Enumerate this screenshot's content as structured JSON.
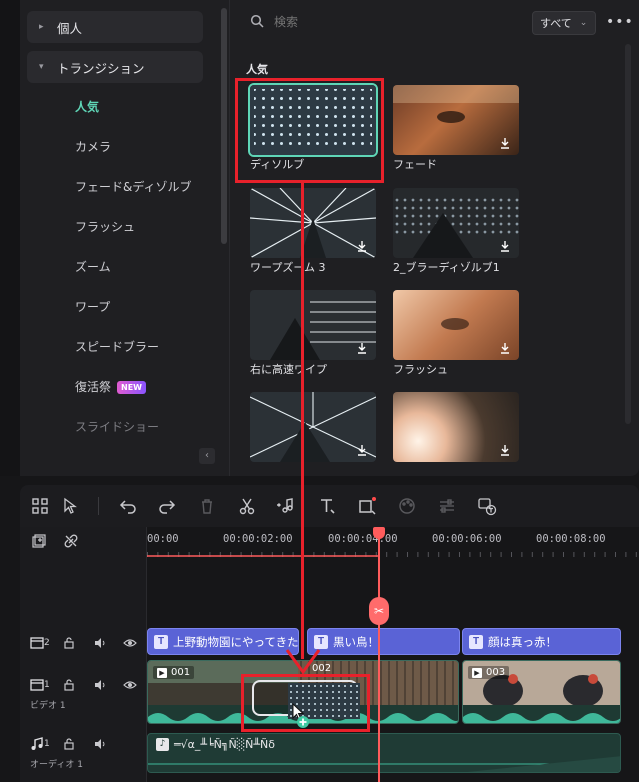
{
  "sidebar": {
    "categories": [
      {
        "label": "個人",
        "expanded": false
      },
      {
        "label": "トランジション",
        "expanded": true
      }
    ],
    "sub_items": [
      {
        "label": "人気",
        "active": true
      },
      {
        "label": "カメラ"
      },
      {
        "label": "フェード&ディゾルブ"
      },
      {
        "label": "フラッシュ"
      },
      {
        "label": "ズーム"
      },
      {
        "label": "ワープ"
      },
      {
        "label": "スピードブラー"
      },
      {
        "label": "復活祭",
        "badge": "NEW"
      },
      {
        "label": "スライドショー"
      }
    ]
  },
  "search": {
    "placeholder": "検索"
  },
  "filter": {
    "selected": "すべて"
  },
  "section_title": "人気",
  "tiles": [
    {
      "label": "ディソルブ",
      "selected": true
    },
    {
      "label": "フェード"
    },
    {
      "label": "ワープズーム 3"
    },
    {
      "label": "2_ブラーディゾルブ1"
    },
    {
      "label": "右に高速ワイプ"
    },
    {
      "label": "フラッシュ"
    },
    {
      "label": ""
    },
    {
      "label": ""
    }
  ],
  "timeline": {
    "ruler": [
      "00:00",
      "00:00:02:00",
      "00:00:04:00",
      "00:00:06:00",
      "00:00:08:00"
    ],
    "tracks": {
      "title": {
        "number": "2"
      },
      "video": {
        "number": "1",
        "name": "ビデオ 1"
      },
      "audio": {
        "number": "1",
        "name": "オーディオ 1"
      }
    },
    "title_clips": [
      "上野動物園にやってきた！",
      "黒い鳥！",
      "顔は真っ赤！"
    ],
    "video_clips": [
      "001",
      "002",
      "003"
    ],
    "audio_clip_label": "═√α_╨╘Ñ╗Ñ░Ñ╨Ñδ"
  },
  "colors": {
    "accent": "#5fd6b7",
    "annotation": "#e8212b",
    "playhead": "#ff5c5c",
    "title_clip": "#5a63d6"
  }
}
